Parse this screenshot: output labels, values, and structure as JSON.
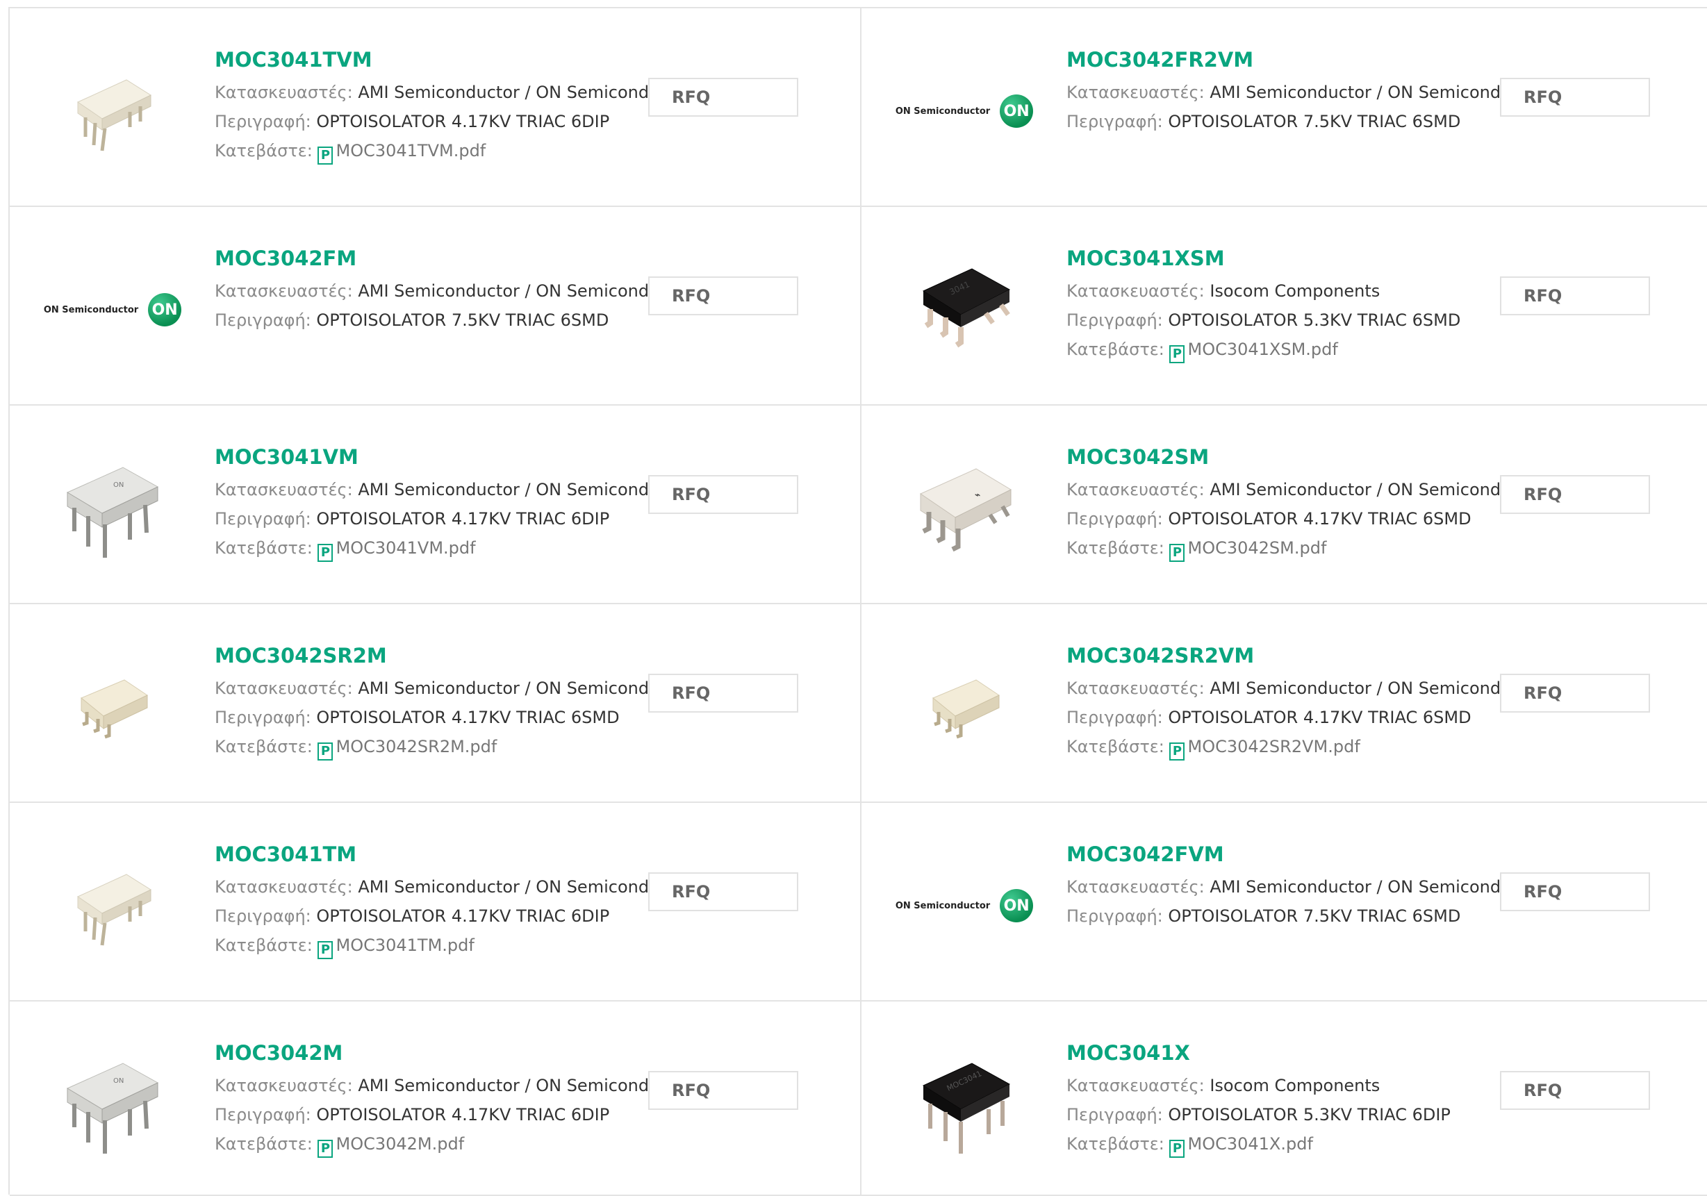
{
  "labels": {
    "manufacturer": "Κατασκευαστές:",
    "description": "Περιγραφή:",
    "download": "Κατεβάστε:",
    "rfq": "RFQ",
    "pdf_glyph": "P"
  },
  "logo": {
    "brand": "ON Semiconductor",
    "mark": "ON"
  },
  "colors": {
    "accent": "#0aa57f",
    "border": "#e3e3e3",
    "label": "#8a8a8a",
    "text": "#333333"
  },
  "products": [
    {
      "part": "MOC3041TVM",
      "manufacturer": "AMI Semiconductor / ON Semiconductor",
      "description": "OPTOISOLATOR 4.17KV TRIAC 6DIP",
      "pdf": "MOC3041TVM.pdf",
      "image": "white-dip-icon"
    },
    {
      "part": "MOC3042FR2VM",
      "manufacturer": "AMI Semiconductor / ON Semiconductor",
      "description": "OPTOISOLATOR 7.5KV TRIAC 6SMD",
      "pdf": "",
      "image": "on-semi-logo"
    },
    {
      "part": "MOC3042FM",
      "manufacturer": "AMI Semiconductor / ON Semiconductor",
      "description": "OPTOISOLATOR 7.5KV TRIAC 6SMD",
      "pdf": "",
      "image": "on-semi-logo"
    },
    {
      "part": "MOC3041XSM",
      "manufacturer": "Isocom Components",
      "description": "OPTOISOLATOR 5.3KV TRIAC 6SMD",
      "pdf": "MOC3041XSM.pdf",
      "image": "black-smd-icon"
    },
    {
      "part": "MOC3041VM",
      "manufacturer": "AMI Semiconductor / ON Semiconductor",
      "description": "OPTOISOLATOR 4.17KV TRIAC 6DIP",
      "pdf": "MOC3041VM.pdf",
      "image": "gray-dip-icon"
    },
    {
      "part": "MOC3042SM",
      "manufacturer": "AMI Semiconductor / ON Semiconductor",
      "description": "OPTOISOLATOR 4.17KV TRIAC 6SMD",
      "pdf": "MOC3042SM.pdf",
      "image": "white-smd-icon"
    },
    {
      "part": "MOC3042SR2M",
      "manufacturer": "AMI Semiconductor / ON Semiconductor",
      "description": "OPTOISOLATOR 4.17KV TRIAC 6SMD",
      "pdf": "MOC3042SR2M.pdf",
      "image": "cream-smd-icon"
    },
    {
      "part": "MOC3042SR2VM",
      "manufacturer": "AMI Semiconductor / ON Semiconductor",
      "description": "OPTOISOLATOR 4.17KV TRIAC 6SMD",
      "pdf": "MOC3042SR2VM.pdf",
      "image": "cream-smd-icon"
    },
    {
      "part": "MOC3041TM",
      "manufacturer": "AMI Semiconductor / ON Semiconductor",
      "description": "OPTOISOLATOR 4.17KV TRIAC 6DIP",
      "pdf": "MOC3041TM.pdf",
      "image": "white-dip-icon"
    },
    {
      "part": "MOC3042FVM",
      "manufacturer": "AMI Semiconductor / ON Semiconductor",
      "description": "OPTOISOLATOR 7.5KV TRIAC 6SMD",
      "pdf": "",
      "image": "on-semi-logo"
    },
    {
      "part": "MOC3042M",
      "manufacturer": "AMI Semiconductor / ON Semiconductor",
      "description": "OPTOISOLATOR 4.17KV TRIAC 6DIP",
      "pdf": "MOC3042M.pdf",
      "image": "gray-dip-icon"
    },
    {
      "part": "MOC3041X",
      "manufacturer": "Isocom Components",
      "description": "OPTOISOLATOR 5.3KV TRIAC 6DIP",
      "pdf": "MOC3041X.pdf",
      "image": "black-dip-icon"
    }
  ]
}
